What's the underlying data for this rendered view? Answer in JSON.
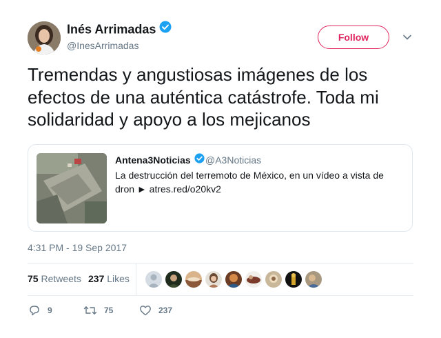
{
  "author": {
    "name": "Inés Arrimadas",
    "handle": "@InesArrimadas",
    "verified": true
  },
  "follow_label": "Follow",
  "tweet_text": "Tremendas y angustiosas imágenes de los efectos de una auténtica catástrofe. Toda mi solidaridad y apoyo a los mejicanos",
  "quoted": {
    "name": "Antena3Noticias",
    "handle": "@A3Noticias",
    "verified": true,
    "text": "La destrucción del terremoto de México, en un vídeo a vista de dron ► atres.red/o20kv2"
  },
  "timestamp": "4:31 PM - 19 Sep 2017",
  "stats": {
    "retweets_count": "75",
    "retweets_label": "Retweets",
    "likes_count": "237",
    "likes_label": "Likes"
  },
  "actions": {
    "reply_count": "9",
    "retweet_count": "75",
    "like_count": "237"
  },
  "colors": {
    "accent": "#e0245e",
    "verified": "#1da1f2",
    "muted": "#657786"
  },
  "icons": [
    "verified-badge-icon",
    "chevron-down-icon",
    "reply-icon",
    "retweet-icon",
    "heart-icon"
  ]
}
